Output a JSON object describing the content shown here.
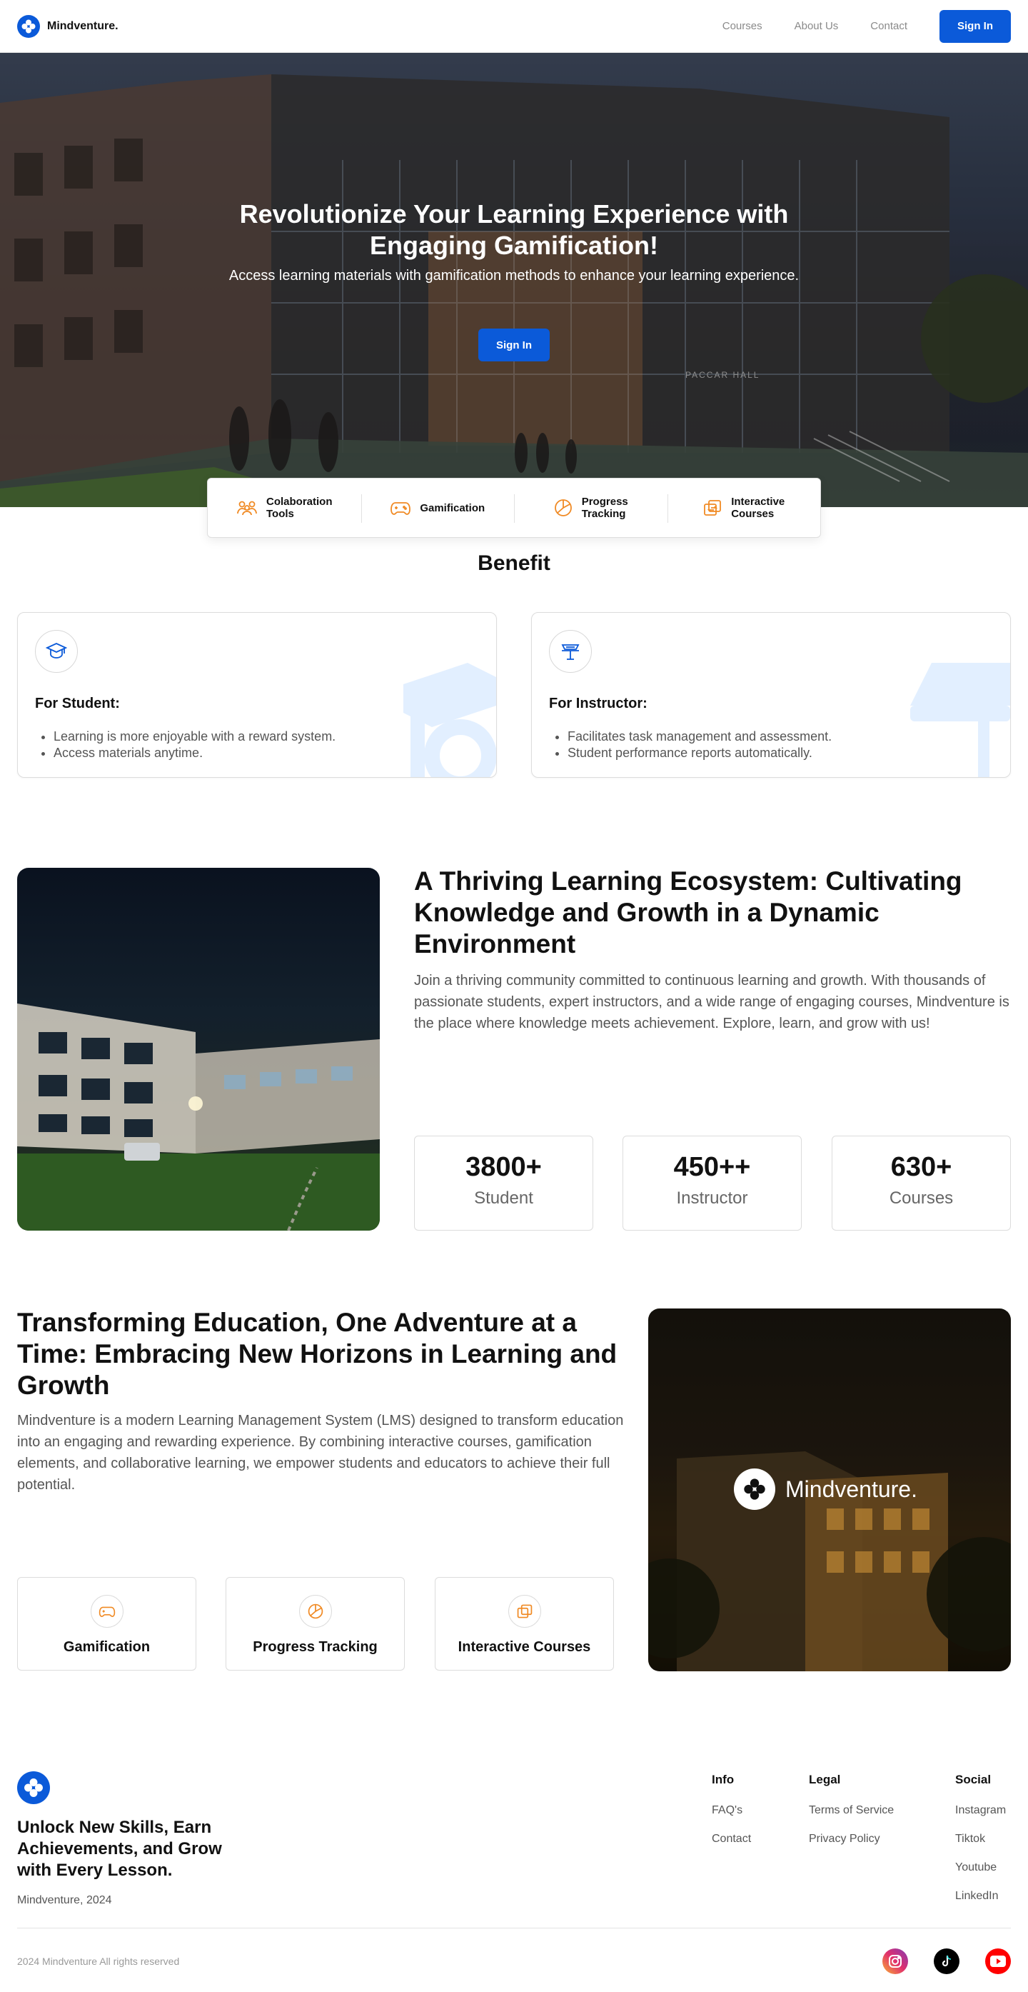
{
  "nav": {
    "brand": "Mindventure.",
    "links": [
      "Courses",
      "About Us",
      "Contact"
    ],
    "signin": "Sign In"
  },
  "hero": {
    "title": "Revolutionize Your Learning Experience with Engaging Gamification!",
    "subtitle": "Access learning materials with gamification methods to enhance your learning experience.",
    "cta": "Sign In",
    "building_sign": "PACCAR HALL"
  },
  "features": [
    {
      "label": "Colaboration\nTools",
      "icon": "collaboration-icon"
    },
    {
      "label": "Gamification",
      "icon": "gamepad-icon"
    },
    {
      "label": "Progress\nTracking",
      "icon": "pie-chart-icon"
    },
    {
      "label": "Interactive\nCourses",
      "icon": "repeat-icon"
    }
  ],
  "benefit": {
    "title": "Benefit",
    "cards": [
      {
        "heading": "For Student:",
        "icon": "graduation-cap-icon",
        "items": [
          "Learning is more enjoyable with a reward system.",
          "Access materials anytime."
        ]
      },
      {
        "heading": "For Instructor:",
        "icon": "lectern-icon",
        "items": [
          "Facilitates task management and assessment.",
          "Student performance reports automatically."
        ]
      }
    ]
  },
  "ecosystem": {
    "title": "A Thriving Learning Ecosystem: Cultivating Knowledge and Growth in a Dynamic Environment",
    "text": "Join a thriving community committed to continuous learning and growth. With thousands of passionate students, expert instructors, and a wide range of engaging courses, Mindventure is the place where knowledge meets achievement. Explore, learn, and grow with us!",
    "stats": [
      {
        "value": "3800+",
        "label": "Student"
      },
      {
        "value": "450++",
        "label": "Instructor"
      },
      {
        "value": "630+",
        "label": "Courses"
      }
    ]
  },
  "transform": {
    "title": "Transforming Education, One Adventure at a Time: Embracing New Horizons in Learning and Growth",
    "text": "Mindventure is a modern Learning Management System (LMS) designed to transform education into an engaging and rewarding experience. By combining interactive courses, gamification elements, and collaborative learning, we empower students and educators to achieve their full potential.",
    "cards": [
      {
        "label": "Gamification",
        "icon": "gamepad-icon"
      },
      {
        "label": "Progress Tracking",
        "icon": "pie-chart-icon"
      },
      {
        "label": "Interactive Courses",
        "icon": "repeat-icon"
      }
    ],
    "brand_label": "Mindventure."
  },
  "footer": {
    "tagline": "Unlock New Skills, Earn Achievements, and Grow with Every Lesson.",
    "copyright_line": "Mindventure, 2024",
    "columns": [
      {
        "title": "Info",
        "links": [
          "FAQ's",
          "Contact"
        ]
      },
      {
        "title": "Legal",
        "links": [
          "Terms of Service",
          "Privacy Policy"
        ]
      },
      {
        "title": "Social",
        "links": [
          "Instagram",
          "Tiktok",
          "Youtube",
          "LinkedIn"
        ]
      }
    ],
    "rights": "2024 Mindventure All rights reserved",
    "social_icons": [
      "instagram-icon",
      "tiktok-icon",
      "youtube-icon"
    ]
  },
  "colors": {
    "primary": "#0b5ad9",
    "accent_orange": "#f08a24",
    "text_dark": "#111111",
    "text_muted": "#555555"
  }
}
